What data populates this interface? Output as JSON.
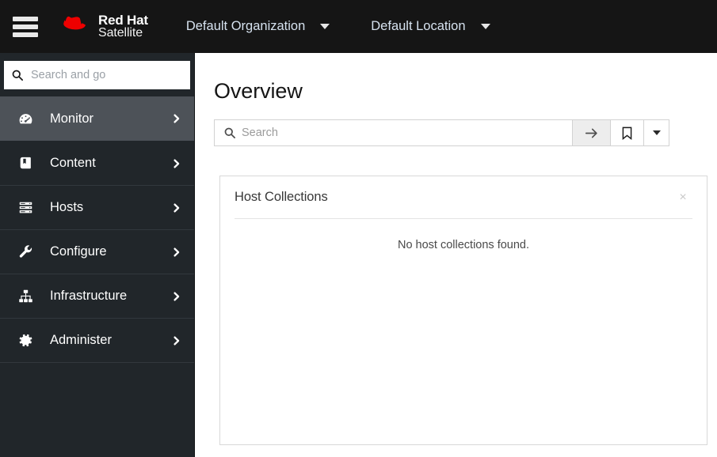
{
  "masthead": {
    "menu_toggle_label": "hamburger-menu",
    "brand": {
      "line1": "Red Hat",
      "line2": "Satellite",
      "logo_color": "#ee0000"
    },
    "organization_switcher": {
      "label": "Default Organization"
    },
    "location_switcher": {
      "label": "Default Location"
    },
    "background_color": "#151515"
  },
  "sidebar": {
    "background_color": "#21262a",
    "active_item_color": "#4d5258",
    "search": {
      "placeholder": "Search and go",
      "value": "",
      "icon": "search-icon"
    },
    "items": [
      {
        "label": "Monitor",
        "icon": "tachometer-icon",
        "active": true
      },
      {
        "label": "Content",
        "icon": "book-icon",
        "active": false
      },
      {
        "label": "Hosts",
        "icon": "server-rack-icon",
        "active": false
      },
      {
        "label": "Configure",
        "icon": "wrench-icon",
        "active": false
      },
      {
        "label": "Infrastructure",
        "icon": "sitemap-icon",
        "active": false
      },
      {
        "label": "Administer",
        "icon": "gear-icon",
        "active": false
      }
    ]
  },
  "main": {
    "page_title": "Overview",
    "search_toolbar": {
      "placeholder": "Search",
      "value": "",
      "search_icon": "search-icon",
      "submit_icon": "arrow-right-icon",
      "bookmark_icon": "bookmark-icon",
      "bookmark_caret_icon": "caret-down-icon"
    },
    "widgets": [
      {
        "title": "Host Collections",
        "close_label": "×",
        "empty_message": "No host collections found."
      }
    ]
  }
}
